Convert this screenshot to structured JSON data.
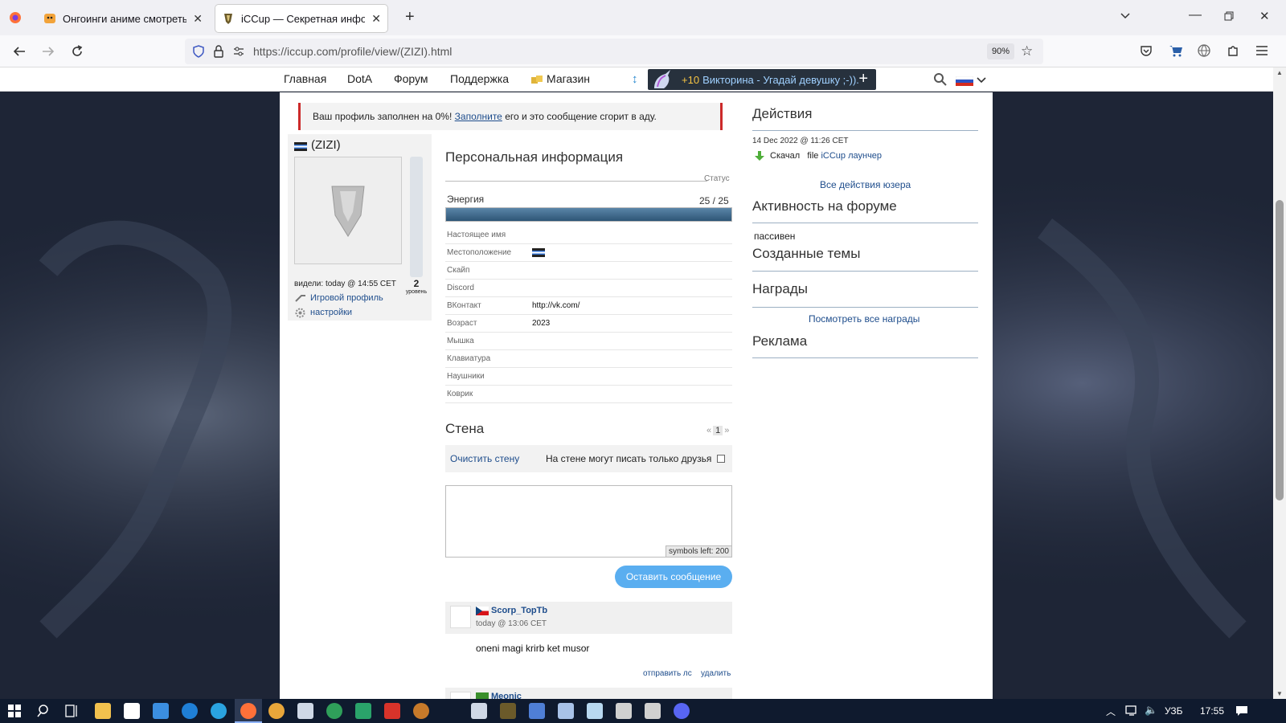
{
  "browser": {
    "tabs": [
      {
        "title": "Онгоинги аниме смотреть онлайн"
      },
      {
        "title": "iCCup — Секретная информация"
      }
    ],
    "url": "https://iccup.com/profile/view/(ZIZI).html",
    "zoom": "90%"
  },
  "site_nav": {
    "items": [
      "Главная",
      "DotA",
      "Форум",
      "Поддержка",
      "Магазин"
    ],
    "quiz_points": "+10",
    "quiz_text": "Викторина - Угадай девушку ;-))."
  },
  "notice": {
    "before": "Ваш профиль заполнен на 0%! ",
    "link": "Заполните",
    "after": " его и это сообщение сгорит в аду."
  },
  "profile": {
    "name": "(ZIZI)",
    "seen": "видели: today @ 14:55 CET",
    "level": "2",
    "level_label": "уровень",
    "game_profile": "Игровой профиль",
    "settings": "настройки"
  },
  "personal": {
    "title": "Персональная информация",
    "status_label": "Статус",
    "energy_label": "Энергия",
    "energy_value": "25 / 25",
    "energy_fraction": 1.0,
    "rows": [
      {
        "label": "Настоящее имя",
        "value": ""
      },
      {
        "label": "Местоположение",
        "value": ""
      },
      {
        "label": "Скайп",
        "value": ""
      },
      {
        "label": "Discord",
        "value": ""
      },
      {
        "label": "ВКонтакт",
        "value": "http://vk.com/"
      },
      {
        "label": "Возраст",
        "value": "2023"
      },
      {
        "label": "Мышка",
        "value": ""
      },
      {
        "label": "Клавиатура",
        "value": ""
      },
      {
        "label": "Наушники",
        "value": ""
      },
      {
        "label": "Коврик",
        "value": ""
      }
    ]
  },
  "wall": {
    "title": "Стена",
    "page_prev": "«",
    "page": "1",
    "page_next": "»",
    "clear": "Очистить стену",
    "friends_only": "На стене могут писать только друзья",
    "symbols_left": "symbols left: 200",
    "submit": "Оставить сообщение",
    "posts": [
      {
        "author": "Scorp_TopTb",
        "time": "today @ 13:06 CET",
        "text": "oneni magi krirb ket musor",
        "send_pm": "отправить лс",
        "delete": "удалить"
      },
      {
        "author": "Meonic"
      }
    ]
  },
  "sidebar": {
    "actions_title": "Действия",
    "action_time": "14 Dec 2022 @ 11:26 CET",
    "action_verb": "Скачал",
    "action_obj_type": "file",
    "action_obj": "iCCup лаунчер",
    "all_actions": "Все действия юзера",
    "forum_title": "Активность на форуме",
    "forum_status": "пассивен",
    "topics_title": "Созданные темы",
    "awards_title": "Награды",
    "all_awards": "Посмотреть все награды",
    "ads_title": "Реклама"
  },
  "taskbar": {
    "lang": "УЗБ",
    "time": "17:55"
  },
  "colors": {
    "energy_bar": "#3b5f7e",
    "notice_border": "#cc2a2a",
    "link": "#1e4d8c",
    "button": "#5aaef0",
    "quiz_bg": "#27313d",
    "page_bg": "#1c2333"
  }
}
